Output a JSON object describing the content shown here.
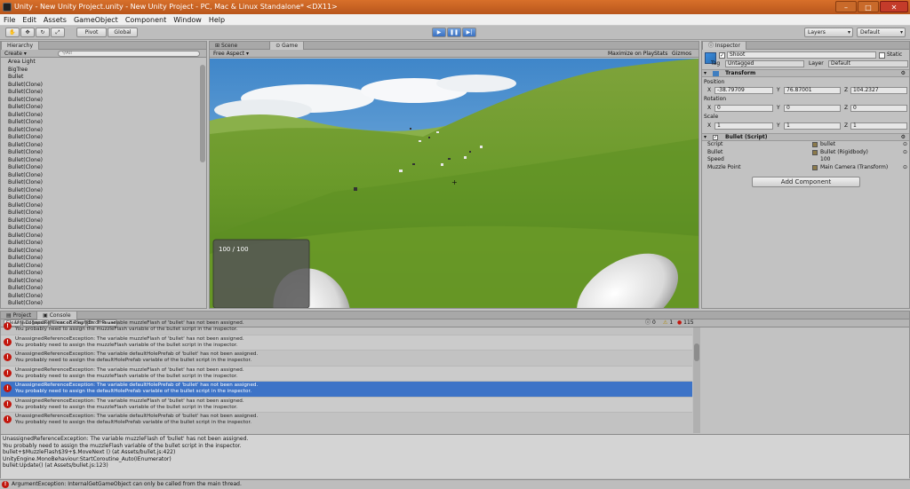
{
  "window": {
    "title": "Unity - New Unity Project.unity - New Unity Project - PC, Mac & Linux Standalone* <DX11>",
    "min": "–",
    "max": "□",
    "close": "✕"
  },
  "menu": [
    "File",
    "Edit",
    "Assets",
    "GameObject",
    "Component",
    "Window",
    "Help"
  ],
  "toolbar": {
    "pivot": "Pivot",
    "global": "Global",
    "layers": "Layers",
    "layout": "Default"
  },
  "hierarchy": {
    "tab": "Hierarchy",
    "create": "Create",
    "search": "All",
    "items": [
      "Area Light",
      "BigTree",
      "Bullet",
      "Bullet(Clone)",
      "Bullet(Clone)",
      "Bullet(Clone)",
      "Bullet(Clone)",
      "Bullet(Clone)",
      "Bullet(Clone)",
      "Bullet(Clone)",
      "Bullet(Clone)",
      "Bullet(Clone)",
      "Bullet(Clone)",
      "Bullet(Clone)",
      "Bullet(Clone)",
      "Bullet(Clone)",
      "Bullet(Clone)",
      "Bullet(Clone)",
      "Bullet(Clone)",
      "Bullet(Clone)",
      "Bullet(Clone)",
      "Bullet(Clone)",
      "Bullet(Clone)",
      "Bullet(Clone)",
      "Bullet(Clone)",
      "Bullet(Clone)",
      "Bullet(Clone)",
      "Bullet(Clone)",
      "Bullet(Clone)",
      "Bullet(Clone)",
      "Bullet(Clone)",
      "Bullet(Clone)",
      "Bullet(Clone)"
    ]
  },
  "game": {
    "scene_tab": "Scene",
    "game_tab": "Game",
    "aspect": "Free Aspect",
    "maximize": "Maximize on Play",
    "stats": "Stats",
    "gizmos": "Gizmos",
    "health": "100 / 100"
  },
  "inspector": {
    "tab": "Inspector",
    "object": "Shoot",
    "static": "Static",
    "tag_label": "Tag",
    "tag": "Untagged",
    "layer_label": "Layer",
    "layer": "Default",
    "transform": "Transform",
    "position": "Position",
    "rotation": "Rotation",
    "scale": "Scale",
    "pos": {
      "x": "-38.79709",
      "y": "76.87001",
      "z": "104.2327"
    },
    "rot": {
      "x": "0",
      "y": "0",
      "z": "0"
    },
    "scl": {
      "x": "1",
      "y": "1",
      "z": "1"
    },
    "x": "X",
    "y": "Y",
    "z": "Z",
    "script_comp": "Bullet (Script)",
    "props": [
      {
        "label": "Script",
        "value": "bullet"
      },
      {
        "label": "Bullet",
        "value": "Bullet (Rigidbody)"
      },
      {
        "label": "Speed",
        "value": "100"
      },
      {
        "label": "Muzzle Point",
        "value": "Main Camera (Transform)"
      }
    ],
    "add_component": "Add Component"
  },
  "console": {
    "project_tab": "Project",
    "console_tab": "Console",
    "clear": "Clear",
    "collapse": "Collapse",
    "clear_on_play": "Clear on Play",
    "error_pause": "Error Pause",
    "count_log": "0",
    "count_warn": "1",
    "count_err": "115",
    "rows": [
      {
        "l1": "UnassignedReferenceException: The variable muzzleFlash of 'bullet' has not been assigned.",
        "l2": "You probably need to assign the muzzleFlash variable of the bullet script in the inspector."
      },
      {
        "l1": "UnassignedReferenceException: The variable muzzleFlash of 'bullet' has not been assigned.",
        "l2": "You probably need to assign the muzzleFlash variable of the bullet script in the inspector."
      },
      {
        "l1": "UnassignedReferenceException: The variable defaultHolePrefab of 'bullet' has not been assigned.",
        "l2": "You probably need to assign the defaultHolePrefab variable of the bullet script in the inspector."
      },
      {
        "l1": "UnassignedReferenceException: The variable muzzleFlash of 'bullet' has not been assigned.",
        "l2": "You probably need to assign the muzzleFlash variable of the bullet script in the inspector."
      },
      {
        "l1": "UnassignedReferenceException: The variable defaultHolePrefab of 'bullet' has not been assigned.",
        "l2": "You probably need to assign the defaultHolePrefab variable of the bullet script in the inspector."
      },
      {
        "l1": "UnassignedReferenceException: The variable muzzleFlash of 'bullet' has not been assigned.",
        "l2": "You probably need to assign the muzzleFlash variable of the bullet script in the inspector."
      },
      {
        "l1": "UnassignedReferenceException: The variable defaultHolePrefab of 'bullet' has not been assigned.",
        "l2": "You probably need to assign the defaultHolePrefab variable of the bullet script in the inspector."
      },
      {
        "l1": "UnassignedReferenceException: The variable muzzleFlash of 'bullet' has not been assigned.",
        "l2": "You probably need to assign the muzzleFlash variable of the bullet script in the inspector."
      }
    ],
    "detail": [
      "UnassignedReferenceException: The variable muzzleFlash of 'bullet' has not been assigned.",
      "You probably need to assign the muzzleFlash variable of the bullet script in the inspector.",
      "bullet+$MuzzleFlash$39+$.MoveNext () (at Assets/bullet.js:422)",
      "UnityEngine.MonoBehaviour:StartCoroutine_Auto(IEnumerator)",
      "bullet:Update() (at Assets/bullet.js:123)"
    ],
    "status": "ArgumentException: InternalGetGameObject can only be called from the main thread."
  }
}
